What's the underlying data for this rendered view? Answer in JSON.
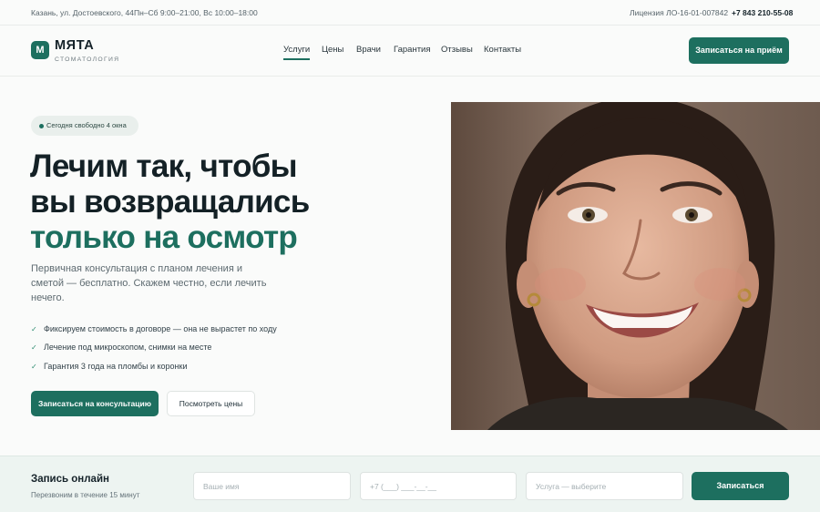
{
  "topbar": {
    "address": "Казань, ул. Достоевского, 44",
    "hours": "Пн–Сб 9:00–21:00, Вс 10:00–18:00",
    "license": "Лицензия ЛО-16-01-007842",
    "phone": "+7 843 210-55-08"
  },
  "header": {
    "logo_letter": "М",
    "logo_name": "МЯТА",
    "logo_sub": "стоматология",
    "nav": [
      "Услуги",
      "Цены",
      "Врачи",
      "Гарантия",
      "Отзывы",
      "Контакты"
    ],
    "active_nav": "Услуги",
    "cta_label": "Записаться на приём"
  },
  "hero": {
    "badge": "Сегодня свободно 4 окна",
    "title_line1": "Лечим так, чтобы",
    "title_line2": "вы возвращались",
    "title_line3": "только на осмотр",
    "lead_line1": "Первичная консультация с планом лечения и",
    "lead_line2": "сметой — бесплатно. Скажем честно, если лечить",
    "lead_line3": "нечего.",
    "checks": [
      "Фиксируем стоимость в договоре — она не вырастет по ходу",
      "Лечение под микроскопом, снимки на месте",
      "Гарантия 3 года на пломбы и коронки"
    ],
    "check_symbol": "✓",
    "primary_button": "Записаться на консультацию",
    "secondary_button": "Посмотреть цены"
  },
  "booking": {
    "title": "Запись онлайн",
    "subtitle": "Перезвоним в течение 15 минут",
    "name_placeholder": "Ваше имя",
    "phone_placeholder": "+7 (___) ___-__-__",
    "service_placeholder": "Услуга — выберите",
    "submit_label": "Записаться"
  },
  "colors": {
    "accent": "#1d6f5f",
    "text": "#142126",
    "muted": "#5d6a70",
    "background": "#fafbfa",
    "booking_background": "#edf4f1"
  }
}
